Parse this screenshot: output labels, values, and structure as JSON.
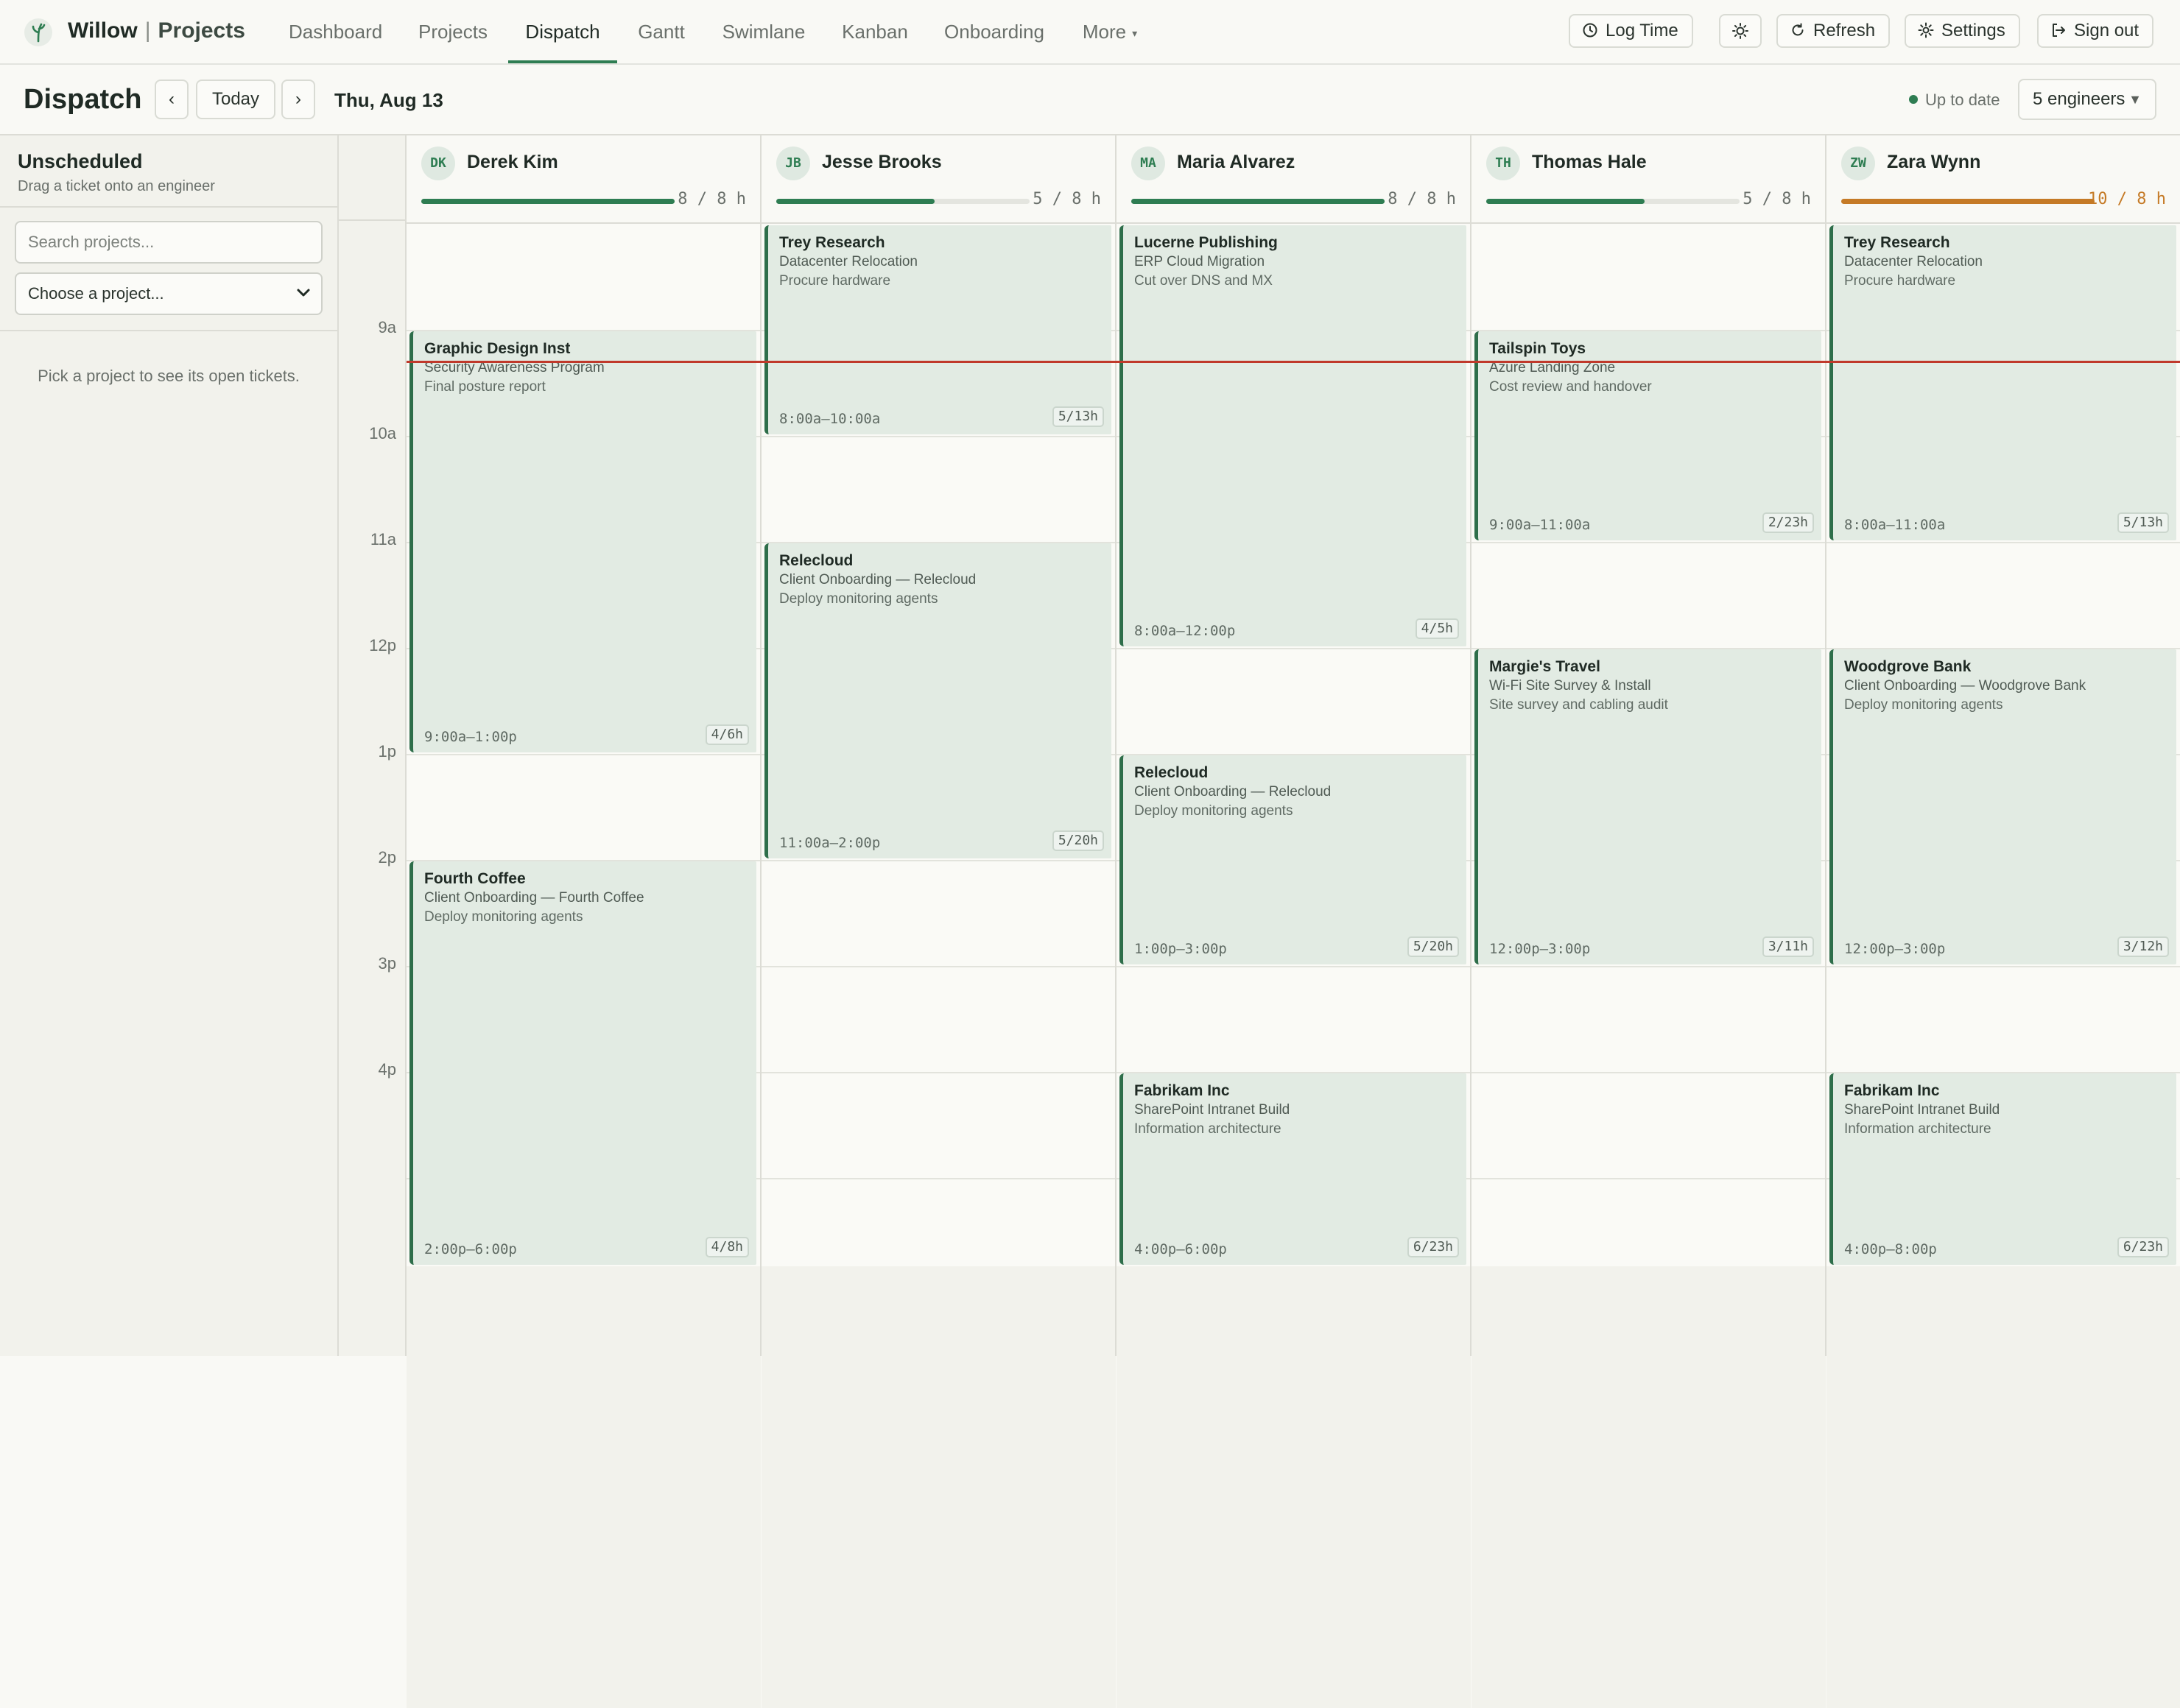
{
  "app": {
    "name": "Willow",
    "separator": "|",
    "section": "Projects"
  },
  "nav": {
    "tabs": [
      {
        "label": "Dashboard"
      },
      {
        "label": "Projects"
      },
      {
        "label": "Dispatch",
        "active": true
      },
      {
        "label": "Gantt"
      },
      {
        "label": "Swimlane"
      },
      {
        "label": "Kanban"
      },
      {
        "label": "Onboarding"
      },
      {
        "label": "More"
      }
    ],
    "buttons": {
      "log_time": "Log Time",
      "refresh": "Refresh",
      "settings": "Settings",
      "sign_out": "Sign out"
    }
  },
  "header": {
    "title": "Dispatch",
    "prev": "‹",
    "today": "Today",
    "next": "›",
    "date": "Thu, Aug 13",
    "status": "Up to date",
    "engineers_select": "5 engineers"
  },
  "unscheduled": {
    "title": "Unscheduled",
    "subtitle": "Drag a ticket onto an engineer",
    "search_placeholder": "Search projects...",
    "project_select": "Choose a project...",
    "empty_text": "Pick a project to see its open tickets."
  },
  "time_labels": [
    "9a",
    "10a",
    "11a",
    "12p",
    "1p",
    "2p",
    "3p",
    "4p"
  ],
  "colors": {
    "accent": "#2e7d52",
    "over": "#c57a26",
    "now_line": "#c0392b",
    "event_bg": "#e2ebe3"
  },
  "engineers": [
    {
      "initials": "DK",
      "name": "Derek Kim",
      "hours": "8 / 8 h",
      "load": 1.0,
      "over": false,
      "events": [
        {
          "client": "Graphic Design Inst",
          "project": "Security Awareness Program",
          "task": "Final posture report",
          "time": "9:00a–1:00p",
          "badge": "4/6h",
          "start": 9,
          "end": 13
        },
        {
          "client": "Fourth Coffee",
          "project": "Client Onboarding — Fourth Coffee",
          "task": "Deploy monitoring agents",
          "time": "2:00p–6:00p",
          "badge": "4/8h",
          "start": 14,
          "end": 18
        }
      ]
    },
    {
      "initials": "JB",
      "name": "Jesse Brooks",
      "hours": "5 / 8 h",
      "load": 0.625,
      "over": false,
      "events": [
        {
          "client": "Trey Research",
          "project": "Datacenter Relocation",
          "task": "Procure hardware",
          "time": "8:00a–10:00a",
          "badge": "5/13h",
          "start": 8,
          "end": 10
        },
        {
          "client": "Relecloud",
          "project": "Client Onboarding — Relecloud",
          "task": "Deploy monitoring agents",
          "time": "11:00a–2:00p",
          "badge": "5/20h",
          "start": 11,
          "end": 14
        }
      ]
    },
    {
      "initials": "MA",
      "name": "Maria Alvarez",
      "hours": "8 / 8 h",
      "load": 1.0,
      "over": false,
      "events": [
        {
          "client": "Lucerne Publishing",
          "project": "ERP Cloud Migration",
          "task": "Cut over DNS and MX",
          "time": "8:00a–12:00p",
          "badge": "4/5h",
          "start": 8,
          "end": 12
        },
        {
          "client": "Relecloud",
          "project": "Client Onboarding — Relecloud",
          "task": "Deploy monitoring agents",
          "time": "1:00p–3:00p",
          "badge": "5/20h",
          "start": 13,
          "end": 15
        },
        {
          "client": "Fabrikam Inc",
          "project": "SharePoint Intranet Build",
          "task": "Information architecture",
          "time": "4:00p–6:00p",
          "badge": "6/23h",
          "start": 16,
          "end": 18
        }
      ]
    },
    {
      "initials": "TH",
      "name": "Thomas Hale",
      "hours": "5 / 8 h",
      "load": 0.625,
      "over": false,
      "events": [
        {
          "client": "Tailspin Toys",
          "project": "Azure Landing Zone",
          "task": "Cost review and handover",
          "time": "9:00a–11:00a",
          "badge": "2/23h",
          "start": 9,
          "end": 11
        },
        {
          "client": "Margie's Travel",
          "project": "Wi-Fi Site Survey & Install",
          "task": "Site survey and cabling audit",
          "time": "12:00p–3:00p",
          "badge": "3/11h",
          "start": 12,
          "end": 15
        }
      ]
    },
    {
      "initials": "ZW",
      "name": "Zara Wynn",
      "hours": "10 / 8 h",
      "load": 1.0,
      "over": true,
      "events": [
        {
          "client": "Trey Research",
          "project": "Datacenter Relocation",
          "task": "Procure hardware",
          "time": "8:00a–11:00a",
          "badge": "5/13h",
          "start": 8,
          "end": 11
        },
        {
          "client": "Woodgrove Bank",
          "project": "Client Onboarding — Woodgrove Bank",
          "task": "Deploy monitoring agents",
          "time": "12:00p–3:00p",
          "badge": "3/12h",
          "start": 12,
          "end": 15
        },
        {
          "client": "Fabrikam Inc",
          "project": "SharePoint Intranet Build",
          "task": "Information architecture",
          "time": "4:00p–8:00p",
          "badge": "6/23h",
          "start": 16,
          "end": 20
        }
      ]
    }
  ]
}
